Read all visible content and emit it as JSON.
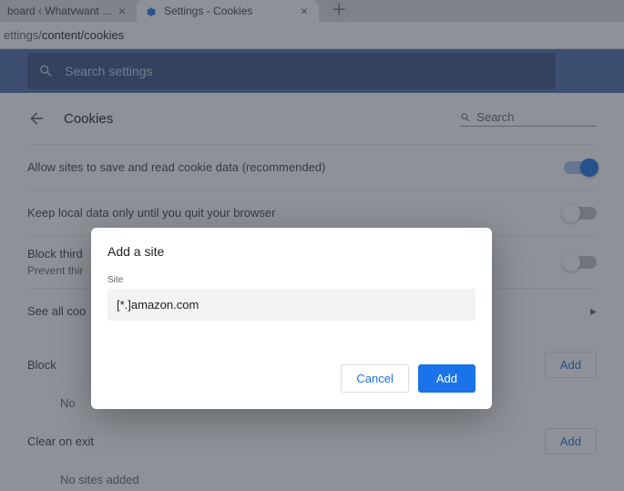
{
  "tabs": {
    "inactive": "board ‹ Whatvwant — Wor",
    "active": "Settings - Cookies"
  },
  "url": {
    "gray": "ettings/",
    "black": "content/cookies"
  },
  "toolbar": {
    "search_placeholder": "Search settings"
  },
  "header": {
    "title": "Cookies",
    "search_placeholder": "Search"
  },
  "settings": {
    "allow": "Allow sites to save and read cookie data (recommended)",
    "keep": "Keep local data only until you quit your browser",
    "third": "Block third",
    "third_sub": "Prevent thir",
    "seeall": "See all coo"
  },
  "sections": {
    "block": {
      "label": "Block",
      "add": "Add",
      "empty": "No"
    },
    "clear": {
      "label": "Clear on exit",
      "add": "Add",
      "empty": "No sites added"
    }
  },
  "dialog": {
    "title": "Add a site",
    "field_label": "Site",
    "value": "[*.]amazon.com",
    "cancel": "Cancel",
    "add": "Add"
  }
}
